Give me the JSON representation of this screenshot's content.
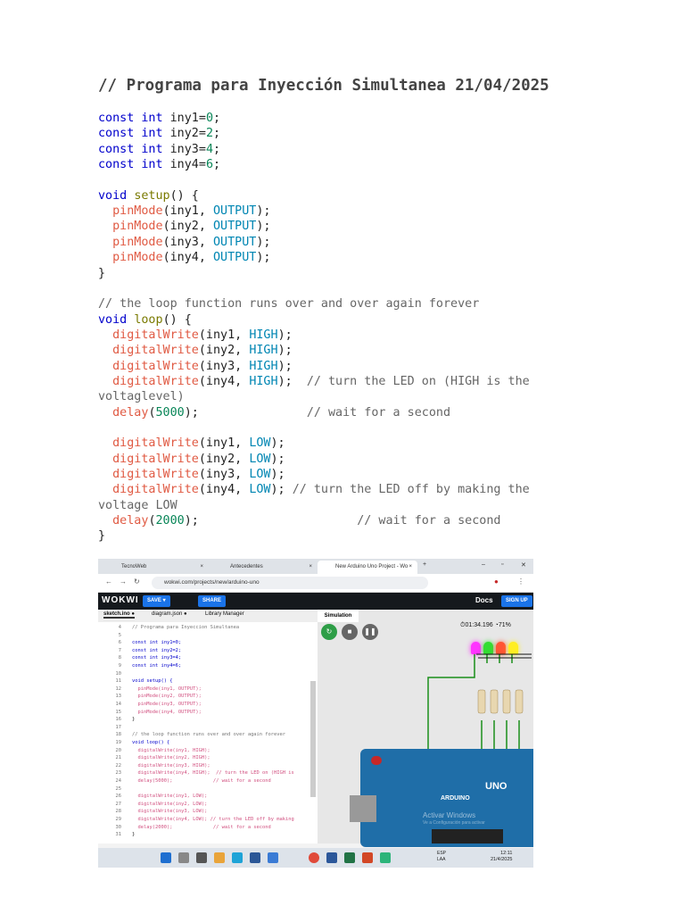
{
  "title": "// Programa para Inyección Simultanea 21/04/2025",
  "code_lines": [
    [
      {
        "t": "const int ",
        "c": "kw"
      },
      {
        "t": "iny1=",
        "c": ""
      },
      {
        "t": "0",
        "c": "num"
      },
      {
        "t": ";",
        "c": ""
      }
    ],
    [
      {
        "t": "const int ",
        "c": "kw"
      },
      {
        "t": "iny2=",
        "c": ""
      },
      {
        "t": "2",
        "c": "num"
      },
      {
        "t": ";",
        "c": ""
      }
    ],
    [
      {
        "t": "const int ",
        "c": "kw"
      },
      {
        "t": "iny3=",
        "c": ""
      },
      {
        "t": "4",
        "c": "num"
      },
      {
        "t": ";",
        "c": ""
      }
    ],
    [
      {
        "t": "const int ",
        "c": "kw"
      },
      {
        "t": "iny4=",
        "c": ""
      },
      {
        "t": "6",
        "c": "num"
      },
      {
        "t": ";",
        "c": ""
      }
    ],
    [],
    [
      {
        "t": "void ",
        "c": "kw"
      },
      {
        "t": "setup",
        "c": "setup"
      },
      {
        "t": "() {",
        "c": ""
      }
    ],
    [
      {
        "t": "  ",
        "c": ""
      },
      {
        "t": "pinMode",
        "c": "fn"
      },
      {
        "t": "(iny1, ",
        "c": ""
      },
      {
        "t": "OUTPUT",
        "c": "const"
      },
      {
        "t": ");",
        "c": ""
      }
    ],
    [
      {
        "t": "  ",
        "c": ""
      },
      {
        "t": "pinMode",
        "c": "fn"
      },
      {
        "t": "(iny2, ",
        "c": ""
      },
      {
        "t": "OUTPUT",
        "c": "const"
      },
      {
        "t": ");",
        "c": ""
      }
    ],
    [
      {
        "t": "  ",
        "c": ""
      },
      {
        "t": "pinMode",
        "c": "fn"
      },
      {
        "t": "(iny3, ",
        "c": ""
      },
      {
        "t": "OUTPUT",
        "c": "const"
      },
      {
        "t": ");",
        "c": ""
      }
    ],
    [
      {
        "t": "  ",
        "c": ""
      },
      {
        "t": "pinMode",
        "c": "fn"
      },
      {
        "t": "(iny4, ",
        "c": ""
      },
      {
        "t": "OUTPUT",
        "c": "const"
      },
      {
        "t": ");",
        "c": ""
      }
    ],
    [
      {
        "t": "}",
        "c": ""
      }
    ],
    [],
    [
      {
        "t": "// the loop function runs over and over again forever",
        "c": "cmt"
      }
    ],
    [
      {
        "t": "void ",
        "c": "kw"
      },
      {
        "t": "loop",
        "c": "setup"
      },
      {
        "t": "() {",
        "c": ""
      }
    ],
    [
      {
        "t": "  ",
        "c": ""
      },
      {
        "t": "digitalWrite",
        "c": "fn"
      },
      {
        "t": "(iny1, ",
        "c": ""
      },
      {
        "t": "HIGH",
        "c": "const"
      },
      {
        "t": ");",
        "c": ""
      }
    ],
    [
      {
        "t": "  ",
        "c": ""
      },
      {
        "t": "digitalWrite",
        "c": "fn"
      },
      {
        "t": "(iny2, ",
        "c": ""
      },
      {
        "t": "HIGH",
        "c": "const"
      },
      {
        "t": ");",
        "c": ""
      }
    ],
    [
      {
        "t": "  ",
        "c": ""
      },
      {
        "t": "digitalWrite",
        "c": "fn"
      },
      {
        "t": "(iny3, ",
        "c": ""
      },
      {
        "t": "HIGH",
        "c": "const"
      },
      {
        "t": ");",
        "c": ""
      }
    ],
    [
      {
        "t": "  ",
        "c": ""
      },
      {
        "t": "digitalWrite",
        "c": "fn"
      },
      {
        "t": "(iny4, ",
        "c": ""
      },
      {
        "t": "HIGH",
        "c": "const"
      },
      {
        "t": ");  ",
        "c": ""
      },
      {
        "t": "// turn the LED on (HIGH is the",
        "c": "cmt"
      }
    ],
    [
      {
        "t": "voltaglevel)",
        "c": "cmt"
      }
    ],
    [
      {
        "t": "  ",
        "c": ""
      },
      {
        "t": "delay",
        "c": "fn"
      },
      {
        "t": "(",
        "c": ""
      },
      {
        "t": "5000",
        "c": "num"
      },
      {
        "t": ");               ",
        "c": ""
      },
      {
        "t": "// wait for a second",
        "c": "cmt"
      }
    ],
    [],
    [
      {
        "t": "  ",
        "c": ""
      },
      {
        "t": "digitalWrite",
        "c": "fn"
      },
      {
        "t": "(iny1, ",
        "c": ""
      },
      {
        "t": "LOW",
        "c": "const"
      },
      {
        "t": ");",
        "c": ""
      }
    ],
    [
      {
        "t": "  ",
        "c": ""
      },
      {
        "t": "digitalWrite",
        "c": "fn"
      },
      {
        "t": "(iny2, ",
        "c": ""
      },
      {
        "t": "LOW",
        "c": "const"
      },
      {
        "t": ");",
        "c": ""
      }
    ],
    [
      {
        "t": "  ",
        "c": ""
      },
      {
        "t": "digitalWrite",
        "c": "fn"
      },
      {
        "t": "(iny3, ",
        "c": ""
      },
      {
        "t": "LOW",
        "c": "const"
      },
      {
        "t": ");",
        "c": ""
      }
    ],
    [
      {
        "t": "  ",
        "c": ""
      },
      {
        "t": "digitalWrite",
        "c": "fn"
      },
      {
        "t": "(iny4, ",
        "c": ""
      },
      {
        "t": "LOW",
        "c": "const"
      },
      {
        "t": "); ",
        "c": ""
      },
      {
        "t": "// turn the LED off by making the",
        "c": "cmt"
      }
    ],
    [
      {
        "t": "voltage LOW",
        "c": "cmt"
      }
    ],
    [
      {
        "t": "  ",
        "c": ""
      },
      {
        "t": "delay",
        "c": "fn"
      },
      {
        "t": "(",
        "c": ""
      },
      {
        "t": "2000",
        "c": "num"
      },
      {
        "t": ");                      ",
        "c": ""
      },
      {
        "t": "// wait for a second",
        "c": "cmt"
      }
    ],
    [
      {
        "t": "}",
        "c": ""
      }
    ]
  ],
  "screenshot": {
    "browser_tabs": [
      "TecnoWeb",
      "Antecedentes",
      "New Arduino Uno Project - Wo"
    ],
    "url": "wokwi.com/projects/new/arduino-uno",
    "wokwi": {
      "logo": "WOKWI",
      "save": "SAVE",
      "share": "SHARE",
      "docs": "Docs",
      "signup": "SIGN UP",
      "editor_tabs": [
        "sketch.ino ●",
        "diagram.json ●",
        "Library Manager"
      ],
      "simulation_tab": "Simulation",
      "timer": "01:34.196",
      "speed": "71%",
      "board_label": "UNO",
      "board_brand": "ARDUINO",
      "watermark": "Activar Windows",
      "watermark_sub": "Ve a Configuración para activar"
    },
    "editor_lines": [
      [
        "4",
        "// Programa para Inyeccion Simultanea"
      ],
      [
        "5",
        ""
      ],
      [
        "6",
        "const int iny1=0;"
      ],
      [
        "7",
        "const int iny2=2;"
      ],
      [
        "8",
        "const int iny3=4;"
      ],
      [
        "9",
        "const int iny4=6;"
      ],
      [
        "10",
        ""
      ],
      [
        "11",
        "void setup() {"
      ],
      [
        "12",
        "  pinMode(iny1, OUTPUT);"
      ],
      [
        "13",
        "  pinMode(iny2, OUTPUT);"
      ],
      [
        "14",
        "  pinMode(iny3, OUTPUT);"
      ],
      [
        "15",
        "  pinMode(iny4, OUTPUT);"
      ],
      [
        "16",
        "}"
      ],
      [
        "17",
        ""
      ],
      [
        "18",
        "// the loop function runs over and over again forever"
      ],
      [
        "19",
        "void loop() {"
      ],
      [
        "20",
        "  digitalWrite(iny1, HIGH);"
      ],
      [
        "21",
        "  digitalWrite(iny2, HIGH);"
      ],
      [
        "22",
        "  digitalWrite(iny3, HIGH);"
      ],
      [
        "23",
        "  digitalWrite(iny4, HIGH);  // turn the LED on (HIGH is"
      ],
      [
        "24",
        "  delay(5000);              // wait for a second"
      ],
      [
        "25",
        ""
      ],
      [
        "26",
        "  digitalWrite(iny1, LOW);"
      ],
      [
        "27",
        "  digitalWrite(iny2, LOW);"
      ],
      [
        "28",
        "  digitalWrite(iny3, LOW);"
      ],
      [
        "29",
        "  digitalWrite(iny4, LOW); // turn the LED off by making"
      ],
      [
        "30",
        "  delay(2000);              // wait for a second"
      ],
      [
        "31",
        "}"
      ]
    ],
    "taskbar": {
      "lang": "ESP\nLAA",
      "time": "12:11",
      "date": "21/4/2025"
    },
    "led_colors": [
      "#ff33ff",
      "#33dd33",
      "#ff5533",
      "#ffee22"
    ]
  }
}
